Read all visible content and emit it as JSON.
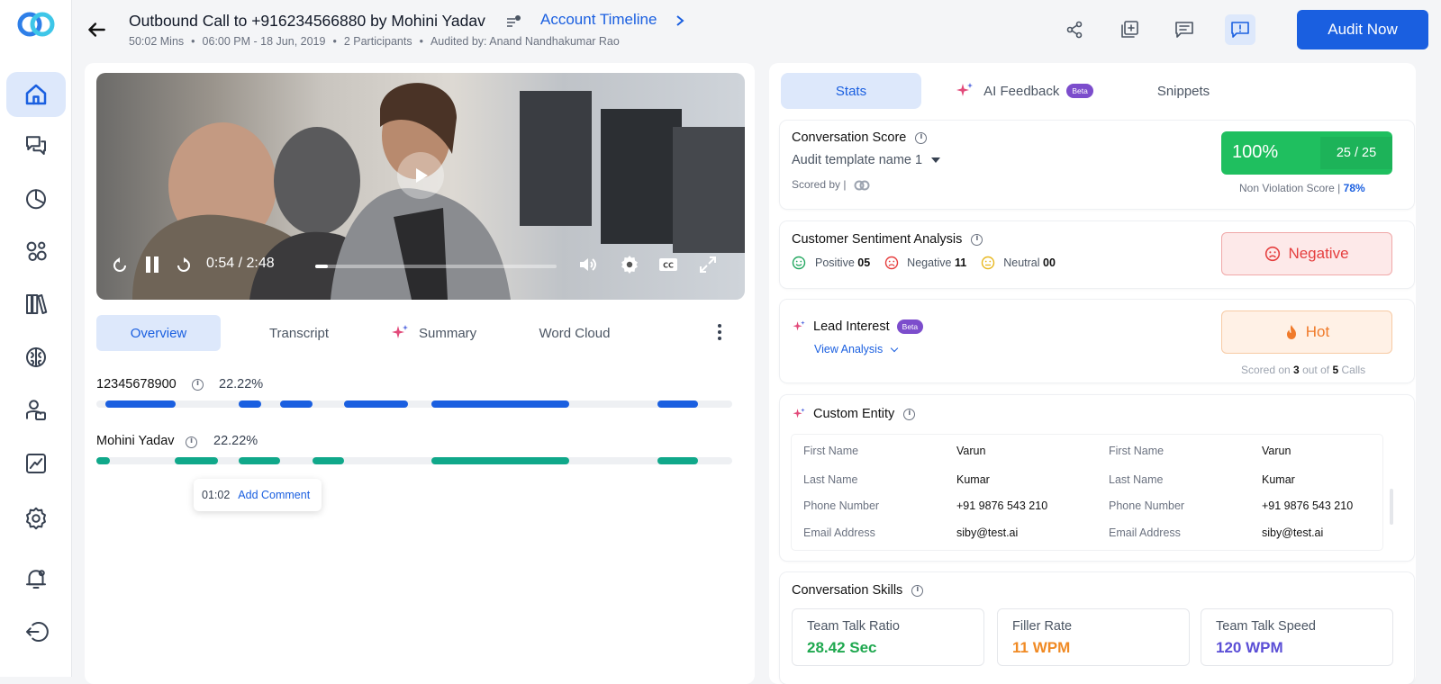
{
  "header": {
    "title": "Outbound Call to +916234566880 by Mohini Yadav",
    "account_timeline": "Account Timeline",
    "meta": {
      "duration": "50:02 Mins",
      "datetime": "06:00 PM - 18 Jun, 2019",
      "participants": "2 Participants",
      "audited_by": "Audited by: Anand Nandhakumar Rao"
    },
    "audit_button": "Audit Now"
  },
  "sidebar": {
    "items": [
      {
        "icon": "home-icon",
        "active": true
      },
      {
        "icon": "chat-icon"
      },
      {
        "icon": "pie-chart-icon"
      },
      {
        "icon": "circles-icon"
      },
      {
        "icon": "library-icon"
      },
      {
        "icon": "brain-icon"
      },
      {
        "icon": "team-icon"
      },
      {
        "icon": "trend-chart-icon"
      },
      {
        "icon": "settings-icon"
      },
      {
        "icon": "bell-icon"
      },
      {
        "icon": "logout-icon"
      }
    ]
  },
  "player": {
    "time": "0:54 / 2:48",
    "progress_fraction": 0.054
  },
  "left_tabs": [
    "Overview",
    "Transcript",
    "Summary",
    "Word Cloud"
  ],
  "speakers": [
    {
      "name": "12345678900",
      "percent": "22.22%",
      "color": "#1a5fe0"
    },
    {
      "name": "Mohini Yadav",
      "percent": "22.22%",
      "color": "#10a88a"
    }
  ],
  "comment_tooltip": {
    "time": "01:02",
    "action": "Add Comment"
  },
  "right_tabs": {
    "stats": "Stats",
    "ai_feedback": "AI Feedback",
    "beta": "Beta",
    "snippets": "Snippets"
  },
  "conversation_score": {
    "title": "Conversation Score",
    "template": "Audit template name 1",
    "scored_by": "Scored by |",
    "percent": "100%",
    "fraction": "25 / 25",
    "non_violation_label": "Non Violation Score |",
    "non_violation_value": "78%"
  },
  "sentiment": {
    "title": "Customer Sentiment Analysis",
    "positive_label": "Positive",
    "positive_count": "05",
    "negative_label": "Negative",
    "negative_count": "11",
    "neutral_label": "Neutral",
    "neutral_count": "00",
    "result": "Negative"
  },
  "lead_interest": {
    "title": "Lead Interest",
    "beta": "Beta",
    "view_analysis": "View Analysis",
    "result": "Hot",
    "scored_prefix": "Scored on",
    "scored_count": "3",
    "scored_mid": "out of",
    "scored_total": "5",
    "scored_suffix": "Calls"
  },
  "custom_entity": {
    "title": "Custom Entity",
    "rows": [
      {
        "k1": "First Name",
        "v1": "Varun",
        "k2": "First Name",
        "v2": "Varun"
      },
      {
        "k1": "Last Name",
        "v1": "Kumar",
        "k2": "Last Name",
        "v2": "Kumar"
      },
      {
        "k1": "Phone Number",
        "v1": "+91 9876 543 210",
        "k2": "Phone Number",
        "v2": "+91 9876 543 210"
      },
      {
        "k1": "Email Address",
        "v1": "siby@test.ai",
        "k2": "Email Address",
        "v2": "siby@test.ai"
      }
    ]
  },
  "skills": {
    "title": "Conversation Skills",
    "items": [
      {
        "label": "Team Talk Ratio",
        "value": "28.42 Sec",
        "color": "#1fa84f"
      },
      {
        "label": "Filler Rate",
        "value": "11 WPM",
        "color": "#f08a24"
      },
      {
        "label": "Team Talk Speed",
        "value": "120 WPM",
        "color": "#5b4fd6"
      }
    ]
  }
}
